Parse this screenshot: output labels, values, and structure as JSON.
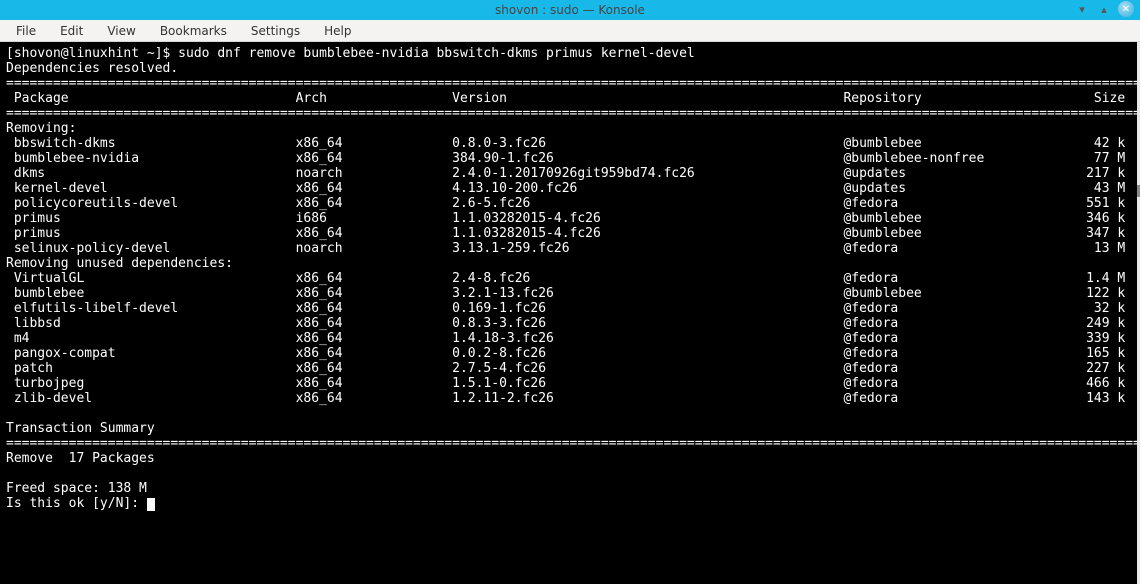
{
  "window": {
    "title": "shovon : sudo — Konsole"
  },
  "menubar": {
    "items": [
      "File",
      "Edit",
      "View",
      "Bookmarks",
      "Settings",
      "Help"
    ]
  },
  "terminal": {
    "prompt": "[shovon@linuxhint ~]$ ",
    "command": "sudo dnf remove bumblebee-nvidia bbswitch-dkms primus kernel-devel",
    "deps_line": "Dependencies resolved.",
    "divider": "====================================================================================================================================================",
    "header": {
      "package": "Package",
      "arch": "Arch",
      "version": "Version",
      "repo": "Repository",
      "size": "Size"
    },
    "removing_label": "Removing:",
    "removing": [
      {
        "pkg": "bbswitch-dkms",
        "arch": "x86_64",
        "ver": "0.8.0-3.fc26",
        "repo": "@bumblebee",
        "size": "42 k"
      },
      {
        "pkg": "bumblebee-nvidia",
        "arch": "x86_64",
        "ver": "384.90-1.fc26",
        "repo": "@bumblebee-nonfree",
        "size": "77 M"
      },
      {
        "pkg": "dkms",
        "arch": "noarch",
        "ver": "2.4.0-1.20170926git959bd74.fc26",
        "repo": "@updates",
        "size": "217 k"
      },
      {
        "pkg": "kernel-devel",
        "arch": "x86_64",
        "ver": "4.13.10-200.fc26",
        "repo": "@updates",
        "size": "43 M"
      },
      {
        "pkg": "policycoreutils-devel",
        "arch": "x86_64",
        "ver": "2.6-5.fc26",
        "repo": "@fedora",
        "size": "551 k"
      },
      {
        "pkg": "primus",
        "arch": "i686",
        "ver": "1.1.03282015-4.fc26",
        "repo": "@bumblebee",
        "size": "346 k"
      },
      {
        "pkg": "primus",
        "arch": "x86_64",
        "ver": "1.1.03282015-4.fc26",
        "repo": "@bumblebee",
        "size": "347 k"
      },
      {
        "pkg": "selinux-policy-devel",
        "arch": "noarch",
        "ver": "3.13.1-259.fc26",
        "repo": "@fedora",
        "size": "13 M"
      }
    ],
    "unused_label": "Removing unused dependencies:",
    "unused": [
      {
        "pkg": "VirtualGL",
        "arch": "x86_64",
        "ver": "2.4-8.fc26",
        "repo": "@fedora",
        "size": "1.4 M"
      },
      {
        "pkg": "bumblebee",
        "arch": "x86_64",
        "ver": "3.2.1-13.fc26",
        "repo": "@bumblebee",
        "size": "122 k"
      },
      {
        "pkg": "elfutils-libelf-devel",
        "arch": "x86_64",
        "ver": "0.169-1.fc26",
        "repo": "@fedora",
        "size": "32 k"
      },
      {
        "pkg": "libbsd",
        "arch": "x86_64",
        "ver": "0.8.3-3.fc26",
        "repo": "@fedora",
        "size": "249 k"
      },
      {
        "pkg": "m4",
        "arch": "x86_64",
        "ver": "1.4.18-3.fc26",
        "repo": "@fedora",
        "size": "339 k"
      },
      {
        "pkg": "pangox-compat",
        "arch": "x86_64",
        "ver": "0.0.2-8.fc26",
        "repo": "@fedora",
        "size": "165 k"
      },
      {
        "pkg": "patch",
        "arch": "x86_64",
        "ver": "2.7.5-4.fc26",
        "repo": "@fedora",
        "size": "227 k"
      },
      {
        "pkg": "turbojpeg",
        "arch": "x86_64",
        "ver": "1.5.1-0.fc26",
        "repo": "@fedora",
        "size": "466 k"
      },
      {
        "pkg": "zlib-devel",
        "arch": "x86_64",
        "ver": "1.2.11-2.fc26",
        "repo": "@fedora",
        "size": "143 k"
      }
    ],
    "summary_label": "Transaction Summary",
    "remove_count": "Remove  17 Packages",
    "freed": "Freed space: 138 M",
    "confirm": "Is this ok [y/N]: "
  }
}
